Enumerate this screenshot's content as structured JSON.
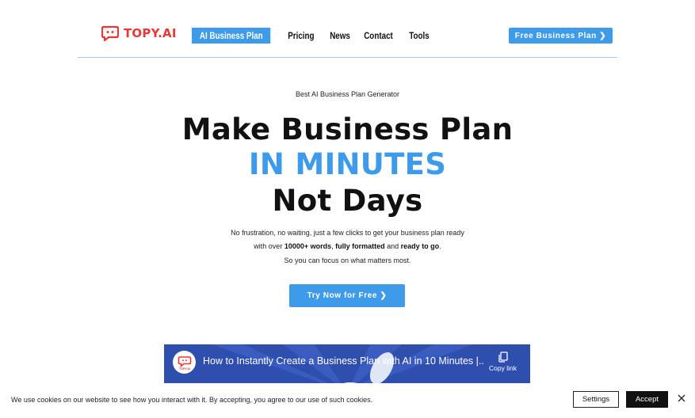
{
  "header": {
    "logo_text": "TOPY.AI",
    "nav": [
      {
        "label": "AI Business Plan",
        "active": true
      },
      {
        "label": "Pricing",
        "active": false
      },
      {
        "label": "News",
        "active": false
      },
      {
        "label": "Contact",
        "active": false
      },
      {
        "label": "Tools",
        "active": false
      }
    ],
    "cta_label": "Free Business Plan ❯"
  },
  "hero": {
    "eyebrow": "Best AI Business Plan Generator",
    "line1": "Make Business Plan",
    "line2": "IN MINUTES",
    "line3": "Not Days",
    "sub1": "No frustration, no waiting, just a few clicks to get your business plan ready",
    "sub2_pre": "with over ",
    "sub2_b1": "10000+ words",
    "sub2_mid1": ", ",
    "sub2_b2": "fully formatted",
    "sub2_mid2": " and ",
    "sub2_b3": "ready to go",
    "sub2_post": ".",
    "sub3": "So you can focus on what matters most.",
    "button_label": "Try Now for Free ❯"
  },
  "video": {
    "channel_badge": "TOPY.AI",
    "title": "How to Instantly Create a Business Plan with AI in 10 Minutes |...",
    "copy_link_label": "Copy link"
  },
  "cookie": {
    "text": "We use cookies on our website to see how you interact with it. By accepting, you agree to our use of such cookies.",
    "settings_label": "Settings",
    "accept_label": "Accept"
  },
  "colors": {
    "accent": "#3d9be9",
    "brand_red": "#e53935",
    "video_bg": "#2f4fae"
  }
}
